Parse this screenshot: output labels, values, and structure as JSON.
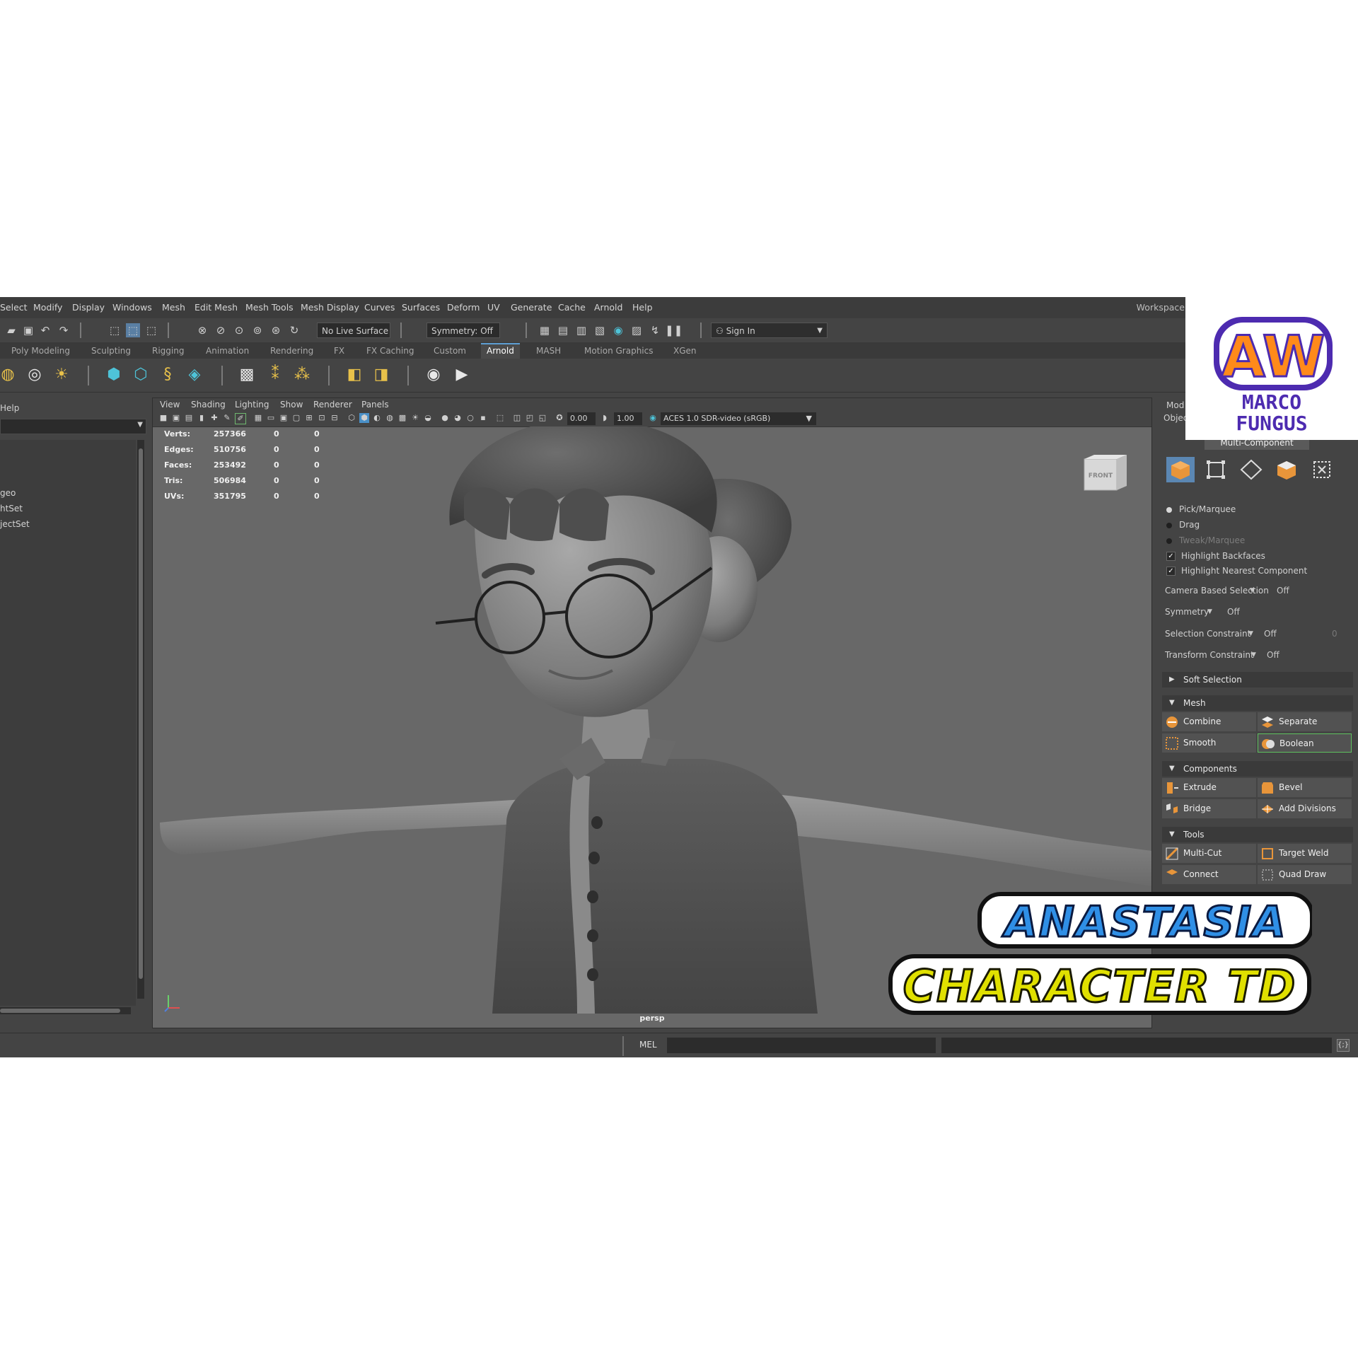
{
  "menubar": {
    "items": [
      "Select",
      "Modify",
      "Display",
      "Windows",
      "Mesh",
      "Edit Mesh",
      "Mesh Tools",
      "Mesh Display",
      "Curves",
      "Surfaces",
      "Deform",
      "UV",
      "Generate",
      "Cache",
      "Arnold",
      "Help"
    ],
    "workspace_label": "Workspace"
  },
  "statusline": {
    "live_surface": "No Live Surface",
    "symmetry": "Symmetry: Off",
    "sign_in": "Sign In"
  },
  "shelf_tabs": [
    "Poly Modeling",
    "Sculpting",
    "Rigging",
    "Animation",
    "Rendering",
    "FX",
    "FX Caching",
    "Custom",
    "Arnold",
    "MASH",
    "Motion Graphics",
    "XGen"
  ],
  "shelf_active_tab": "Arnold",
  "outliner": {
    "menu_help": "Help",
    "items": [
      "geo",
      "htSet",
      "jectSet"
    ]
  },
  "viewport": {
    "menu": [
      "View",
      "Shading",
      "Lighting",
      "Show",
      "Renderer",
      "Panels"
    ],
    "exposure": "0.00",
    "gamma": "1.00",
    "color_space": "ACES 1.0 SDR-video (sRGB)",
    "camera_label": "persp",
    "viewcube_label": "FRONT",
    "hud": [
      {
        "label": "Verts:",
        "value": "257366",
        "sel": "0",
        "comp": "0"
      },
      {
        "label": "Edges:",
        "value": "510756",
        "sel": "0",
        "comp": "0"
      },
      {
        "label": "Faces:",
        "value": "253492",
        "sel": "0",
        "comp": "0"
      },
      {
        "label": "Tris:",
        "value": "506984",
        "sel": "0",
        "comp": "0"
      },
      {
        "label": "UVs:",
        "value": "351795",
        "sel": "0",
        "comp": "0"
      }
    ]
  },
  "modeling_toolkit": {
    "tab_mod": "Mod",
    "tab_obj": "Objec",
    "mode": "Multi-Component",
    "selection_modes": [
      {
        "label": "Pick/Marquee",
        "state": "selected"
      },
      {
        "label": "Drag",
        "state": "normal"
      },
      {
        "label": "Tweak/Marquee",
        "state": "disabled"
      }
    ],
    "checkboxes": [
      {
        "label": "Highlight Backfaces",
        "checked": true
      },
      {
        "label": "Highlight Nearest Component",
        "checked": true
      }
    ],
    "options": [
      {
        "label": "Camera Based Selection",
        "value": "Off"
      },
      {
        "label": "Symmetry",
        "value": "Off"
      },
      {
        "label": "Selection Constraint",
        "value": "Off",
        "extra": "0"
      },
      {
        "label": "Transform Constraint",
        "value": "Off"
      }
    ],
    "soft_selection": "Soft Selection",
    "sections": {
      "mesh": {
        "title": "Mesh",
        "buttons": [
          "Combine",
          "Separate",
          "Smooth",
          "Boolean"
        ]
      },
      "components": {
        "title": "Components",
        "buttons": [
          "Extrude",
          "Bevel",
          "Bridge",
          "Add Divisions"
        ]
      },
      "tools": {
        "title": "Tools",
        "buttons": [
          "Multi-Cut",
          "Target Weld",
          "Connect",
          "Quad Draw"
        ]
      }
    }
  },
  "commandline": {
    "label": "MEL"
  },
  "overlays": {
    "logo_letters": "AW",
    "logo_name_1": "MARCO",
    "logo_name_2": "FUNGUS",
    "title_1": "ANASTASIA",
    "title_2": "CHARACTER TD"
  },
  "colors": {
    "accent_blue": "#5e9fd3",
    "highlight_green": "#5fc25f",
    "logo_orange": "#ff8a1a",
    "logo_purple": "#4d2bb0",
    "title_blue": "#2f8fe6",
    "title_yellow": "#e0e000"
  }
}
